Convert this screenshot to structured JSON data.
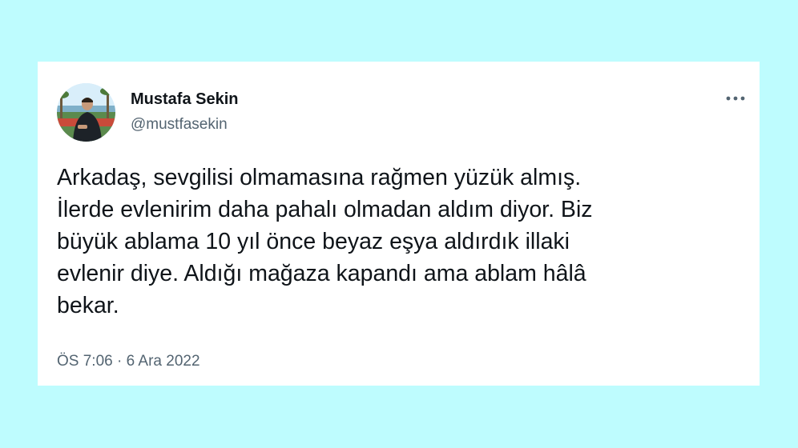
{
  "author": {
    "name": "Mustafa Sekin",
    "handle": "@mustfasekin"
  },
  "tweet": {
    "lines": [
      "Arkadaş, sevgilisi olmamasına rağmen yüzük almış.",
      "İlerde evlenirim daha pahalı olmadan aldım diyor. Biz",
      "büyük ablama 10 yıl önce beyaz eşya aldırdık illaki",
      "evlenir diye. Aldığı mağaza kapandı ama ablam hâlâ",
      "bekar."
    ],
    "time": "ÖS 7:06",
    "separator": "·",
    "date": "6 Ara 2022"
  },
  "icons": {
    "more": "more-horizontal-icon",
    "avatar": "profile-photo"
  },
  "colors": {
    "background": "#befcfe",
    "card": "#ffffff",
    "text_primary": "#0f1419",
    "text_secondary": "#536471"
  }
}
